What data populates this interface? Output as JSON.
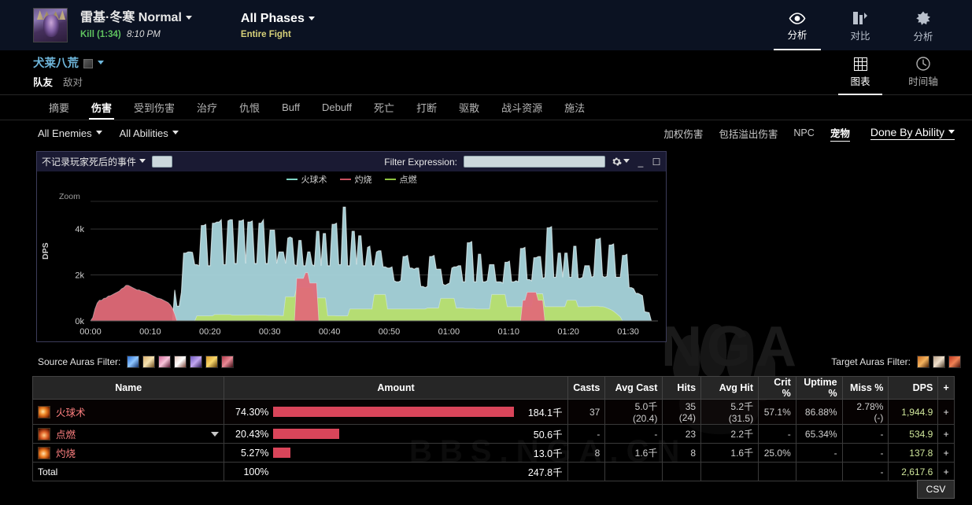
{
  "header": {
    "boss_name": "雷基·冬寒 Normal",
    "result": "Kill (1:34)",
    "time": "8:10 PM",
    "phase_title": "All Phases",
    "phase_sub": "Entire Fight",
    "nav": [
      {
        "label": "分析",
        "icon": "eye-icon",
        "active": true
      },
      {
        "label": "对比",
        "icon": "compare-bars-icon",
        "active": false
      },
      {
        "label": "分析",
        "icon": "puzzle-piece-icon",
        "active": false
      }
    ]
  },
  "player": {
    "name": "犬莱八荒",
    "subtabs": [
      {
        "label": "队友",
        "active": true
      },
      {
        "label": "敌对",
        "active": false
      }
    ],
    "viewnav": [
      {
        "label": "图表",
        "icon": "grid-icon",
        "active": true
      },
      {
        "label": "时间轴",
        "icon": "clock-icon",
        "active": false
      }
    ]
  },
  "main_tabs": [
    {
      "label": "摘要",
      "active": false
    },
    {
      "label": "伤害",
      "active": true
    },
    {
      "label": "受到伤害",
      "active": false
    },
    {
      "label": "治疗",
      "active": false
    },
    {
      "label": "仇恨",
      "active": false
    },
    {
      "label": "Buff",
      "active": false
    },
    {
      "label": "Debuff",
      "active": false
    },
    {
      "label": "死亡",
      "active": false
    },
    {
      "label": "打断",
      "active": false
    },
    {
      "label": "驱散",
      "active": false
    },
    {
      "label": "战斗资源",
      "active": false
    },
    {
      "label": "施法",
      "active": false
    }
  ],
  "filters": {
    "enemies": "All Enemies",
    "abilities": "All Abilities",
    "right": [
      {
        "label": "加权伤害",
        "active": false
      },
      {
        "label": "包括溢出伤害",
        "active": false
      },
      {
        "label": "NPC",
        "active": false
      },
      {
        "label": "宠物",
        "active": true
      }
    ],
    "view_mode": "Done By Ability"
  },
  "chart_panel": {
    "title": "不记录玩家死后的事件",
    "filter_expression_label": "Filter Expression:",
    "filter_expression_value": "",
    "gear_icon": "gear-icon",
    "minimize_icon": "minimize-icon",
    "maximize_icon": "maximize-icon",
    "zoom_label": "Zoom"
  },
  "auras": {
    "source_label": "Source Auras Filter:",
    "target_label": "Target Auras Filter:",
    "source_icons": [
      "aura-frost-blue",
      "aura-arcane-gold",
      "aura-fire-pink",
      "aura-holy-white",
      "aura-shadow-violet",
      "aura-nature-orange",
      "aura-spell-crimson"
    ],
    "target_icons": [
      "aura-ignite-orange",
      "aura-scorch-tan",
      "aura-fire-red"
    ]
  },
  "table": {
    "columns": [
      "Name",
      "Amount",
      "Casts",
      "Avg Cast",
      "Hits",
      "Avg Hit",
      "Crit %",
      "Uptime %",
      "Miss %",
      "DPS",
      "+"
    ],
    "rows": [
      {
        "name": "火球术",
        "icon": "spell-fireball-icon",
        "percent": "74.30%",
        "percent_value": 74.3,
        "amount": "184.1千",
        "casts": "37",
        "avg_cast": "5.0千 (20.4)",
        "hits": "35 (24)",
        "avg_hit": "5.2千 (31.5)",
        "crit": "57.1%",
        "uptime": "86.88%",
        "miss": "2.78% (-)",
        "dps": "1,944.9",
        "plus": "+",
        "has_dropdown": false
      },
      {
        "name": "点燃",
        "icon": "spell-ignite-icon",
        "percent": "20.43%",
        "percent_value": 20.43,
        "amount": "50.6千",
        "casts": "-",
        "avg_cast": "-",
        "hits": "23",
        "avg_hit": "2.2千",
        "crit": "-",
        "uptime": "65.34%",
        "miss": "-",
        "dps": "534.9",
        "plus": "+",
        "has_dropdown": true
      },
      {
        "name": "灼烧",
        "icon": "spell-scorch-icon",
        "percent": "5.27%",
        "percent_value": 5.27,
        "amount": "13.0千",
        "casts": "8",
        "avg_cast": "1.6千",
        "hits": "8",
        "avg_hit": "1.6千",
        "crit": "25.0%",
        "uptime": "-",
        "miss": "-",
        "dps": "137.8",
        "plus": "+",
        "has_dropdown": false
      }
    ],
    "total": {
      "name": "Total",
      "percent": "100%",
      "amount": "247.8千",
      "casts": "",
      "avg_cast": "",
      "hits": "",
      "avg_hit": "",
      "crit": "",
      "uptime": "",
      "miss": "-",
      "dps": "2,617.6",
      "plus": "+"
    }
  },
  "csv_button": "CSV",
  "watermark": "NGA",
  "watermark_sub": "BBS.NGA.CN",
  "chart_data": {
    "type": "area",
    "title": "不记录玩家死后的事件",
    "xlabel": "",
    "ylabel": "DPS",
    "ylim": [
      0,
      5200
    ],
    "yticks": [
      0,
      2000,
      4000
    ],
    "ytick_labels": [
      "0k",
      "2k",
      "4k"
    ],
    "xlim": [
      0,
      95
    ],
    "xticks": [
      0,
      10,
      20,
      30,
      40,
      50,
      60,
      70,
      80,
      90
    ],
    "xtick_labels": [
      "00:00",
      "00:10",
      "00:20",
      "00:30",
      "00:40",
      "00:50",
      "01:00",
      "01:10",
      "01:20",
      "01:30"
    ],
    "grid": true,
    "legend_position": "top",
    "colors": {
      "火球术": "#a8d5dc",
      "灼烧": "#e06a78",
      "点燃": "#b6dd6e"
    },
    "series": [
      {
        "name": "火球术",
        "color": "#a8d5dc",
        "values": [
          0,
          0,
          0,
          0,
          0,
          0,
          0,
          0,
          0,
          0,
          0,
          0,
          0,
          0,
          0,
          0,
          0,
          0,
          0,
          0,
          0,
          0,
          0,
          0,
          0,
          0,
          0,
          0,
          0,
          0,
          0,
          0,
          0,
          0,
          0,
          0,
          0,
          0,
          1350,
          640,
          640,
          1250,
          2950,
          2950,
          3000,
          3000,
          2980,
          2450,
          2450,
          2400,
          4150,
          4150,
          4200,
          2400,
          2400,
          4250,
          4250,
          4300,
          4300,
          4400,
          2450,
          2450,
          4350,
          4400,
          4400,
          2500,
          2500,
          4350,
          4350,
          4400,
          2500,
          4300,
          4300,
          4350,
          2500,
          2500,
          4250,
          4250,
          4400,
          2500,
          2500,
          3950,
          3950,
          3950,
          2500,
          3000,
          3000,
          3000,
          2500,
          3600,
          3650,
          3600,
          2450,
          2400,
          3500,
          3500,
          2400,
          2400,
          3000,
          3000,
          2450,
          2400,
          3900,
          3900,
          2400,
          3800,
          3800,
          2400,
          2400,
          4200,
          4200,
          4250,
          2450,
          2450,
          4950,
          4950,
          2400,
          2400,
          3900,
          3900,
          2450,
          3700,
          3700,
          2400,
          2400,
          3200,
          3250,
          2400,
          2400,
          3000,
          3050,
          3050,
          2350,
          2350,
          2300,
          2300,
          2350,
          1750,
          1700,
          1700,
          1750,
          2800,
          2800,
          2850,
          2300,
          2300,
          2250,
          2300,
          2300,
          1500,
          1500,
          1450,
          1500,
          2800,
          2800,
          2850,
          2250,
          2250,
          2250,
          1600,
          1550,
          1600,
          1650,
          2300,
          2350,
          2350,
          2400,
          2400,
          1700,
          1700,
          3400,
          3400,
          3450,
          1700,
          1700,
          2900,
          2900,
          1700,
          1700,
          1750,
          2450,
          2450,
          2450,
          1700,
          1700,
          1700,
          1650,
          2550,
          2550,
          2600,
          1700,
          1700,
          1750,
          1700,
          3150,
          3150,
          3200,
          1800,
          1800,
          1750,
          2750,
          2750,
          2800,
          2800,
          1850,
          1900,
          4050,
          4050,
          4100,
          1900,
          1900,
          2950,
          2950,
          1900,
          2950,
          2950,
          1900,
          1900,
          3250,
          3250,
          1850,
          1850,
          1900,
          2400,
          2400,
          2400,
          1900,
          1950,
          3550,
          3550,
          3600,
          1950,
          1900,
          1950,
          3300,
          3300,
          3350,
          1900,
          1900,
          1900,
          2850,
          2850,
          2900,
          1450,
          1450,
          1400,
          1200,
          1200,
          1150,
          1100,
          400,
          380,
          360,
          0,
          0,
          0,
          0
        ]
      },
      {
        "name": "点燃",
        "color": "#b6dd6e",
        "values": [
          0,
          0,
          0,
          0,
          0,
          0,
          0,
          0,
          0,
          0,
          0,
          0,
          0,
          0,
          0,
          0,
          0,
          0,
          0,
          0,
          0,
          0,
          0,
          0,
          0,
          0,
          0,
          0,
          0,
          0,
          0,
          0,
          0,
          0,
          0,
          0,
          0,
          0,
          0,
          0,
          0,
          0,
          0,
          0,
          0,
          0,
          0,
          0,
          220,
          220,
          220,
          220,
          220,
          220,
          220,
          220,
          280,
          280,
          280,
          280,
          280,
          280,
          280,
          280,
          250,
          250,
          250,
          250,
          250,
          250,
          250,
          250,
          260,
          260,
          260,
          260,
          250,
          250,
          250,
          250,
          240,
          240,
          240,
          240,
          240,
          240,
          230,
          230,
          1050,
          1050,
          1050,
          1050,
          1050,
          1450,
          1450,
          1450,
          1450,
          1450,
          1450,
          1450,
          1450,
          1000,
          1000,
          1000,
          1000,
          1000,
          1000,
          230,
          230,
          230,
          230,
          220,
          220,
          220,
          220,
          220,
          220,
          520,
          520,
          520,
          520,
          520,
          520,
          520,
          520,
          520,
          520,
          520,
          1150,
          1150,
          1150,
          1150,
          1150,
          1150,
          520,
          520,
          520,
          520,
          520,
          520,
          520,
          520,
          520,
          520,
          520,
          520,
          520,
          520,
          520,
          520,
          520,
          520,
          560,
          560,
          560,
          560,
          560,
          560,
          980,
          980,
          980,
          980,
          980,
          980,
          980,
          560,
          560,
          560,
          560,
          540,
          540,
          540,
          540,
          540,
          520,
          520,
          520,
          520,
          520,
          520,
          520,
          1150,
          1150,
          1150,
          1150,
          1150,
          1150,
          1150,
          620,
          620,
          620,
          620,
          620,
          620,
          620,
          620,
          620,
          620,
          620,
          620,
          1180,
          1180,
          1180,
          1180,
          1180,
          620,
          620,
          620,
          620,
          620,
          620,
          620,
          620,
          620,
          620,
          900,
          900,
          900,
          900,
          900,
          620,
          620,
          620,
          620,
          620,
          620,
          640,
          640,
          640,
          640,
          620,
          620,
          600,
          560,
          520,
          480,
          420,
          340,
          260,
          180,
          0,
          0,
          0,
          0
        ]
      },
      {
        "name": "灼烧",
        "color": "#e06a78",
        "values": [
          0,
          150,
          520,
          780,
          900,
          900,
          980,
          1000,
          1080,
          1100,
          1150,
          1200,
          1250,
          1300,
          1400,
          1450,
          1550,
          1550,
          1500,
          1450,
          1400,
          1350,
          1350,
          1300,
          1280,
          1250,
          1200,
          1150,
          1100,
          1050,
          1000,
          980,
          950,
          900,
          850,
          800,
          700,
          550,
          300,
          0,
          0,
          0,
          0,
          0,
          0,
          0,
          0,
          0,
          0,
          0,
          0,
          0,
          0,
          0,
          0,
          0,
          0,
          0,
          0,
          0,
          0,
          0,
          0,
          0,
          0,
          0,
          0,
          0,
          0,
          0,
          0,
          0,
          0,
          0,
          0,
          0,
          0,
          0,
          0,
          0,
          0,
          0,
          0,
          0,
          0,
          0,
          0,
          0,
          0,
          0,
          0,
          0,
          0,
          1850,
          1850,
          1850,
          1850,
          2100,
          2100,
          1650,
          1650,
          1650,
          1650,
          0,
          0,
          0,
          0,
          0,
          0,
          0,
          0,
          0,
          0,
          0,
          0,
          0,
          0,
          0,
          0,
          0,
          0,
          0,
          0,
          0,
          0,
          0,
          0,
          0,
          0,
          0,
          0,
          0,
          0,
          0,
          0,
          0,
          0,
          0,
          0,
          0,
          0,
          0,
          0,
          0,
          0,
          0,
          0,
          0,
          0,
          0,
          0,
          0,
          0,
          0,
          0,
          0,
          0,
          0,
          0,
          0,
          0,
          0,
          0,
          0,
          0,
          0,
          0,
          0,
          0,
          0,
          0,
          0,
          0,
          0,
          0,
          0,
          0,
          0,
          0,
          0,
          0,
          0,
          0,
          0,
          0,
          0,
          0,
          0,
          0,
          0,
          0,
          0,
          0,
          0,
          0,
          900,
          900,
          1250,
          1250,
          1250,
          1250,
          1250,
          900,
          900,
          900,
          0,
          0,
          0,
          0,
          0,
          0,
          0,
          0,
          0,
          0,
          0,
          0,
          0,
          0,
          0,
          0,
          0,
          0,
          0,
          0,
          0,
          0,
          0,
          0,
          0,
          0,
          0,
          0,
          0,
          0,
          0,
          0,
          0,
          0
        ]
      }
    ]
  }
}
